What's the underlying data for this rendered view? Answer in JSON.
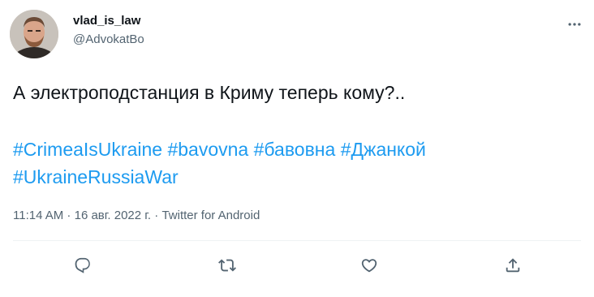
{
  "user": {
    "display_name": "vlad_is_law",
    "handle": "@AdvokatBo"
  },
  "tweet": {
    "text": "А электроподстанция в Криму теперь кому?..",
    "hashtags": [
      "#CrimeaIsUkraine",
      "#bavovna",
      "#бавовна",
      "#Джанкой",
      "#UkraineRussiaWar"
    ]
  },
  "meta": {
    "time": "11:14 AM",
    "sep1": " · ",
    "date": "16 авг. 2022 г.",
    "sep2": " · ",
    "source": "Twitter for Android"
  },
  "actions": {
    "reply_icon": "reply-icon",
    "retweet_icon": "retweet-icon",
    "like_icon": "like-icon",
    "share_icon": "share-icon"
  },
  "colors": {
    "accent": "#1d9bf0",
    "text": "#0f1419",
    "secondary": "#536471",
    "divider": "#eff3f4"
  }
}
